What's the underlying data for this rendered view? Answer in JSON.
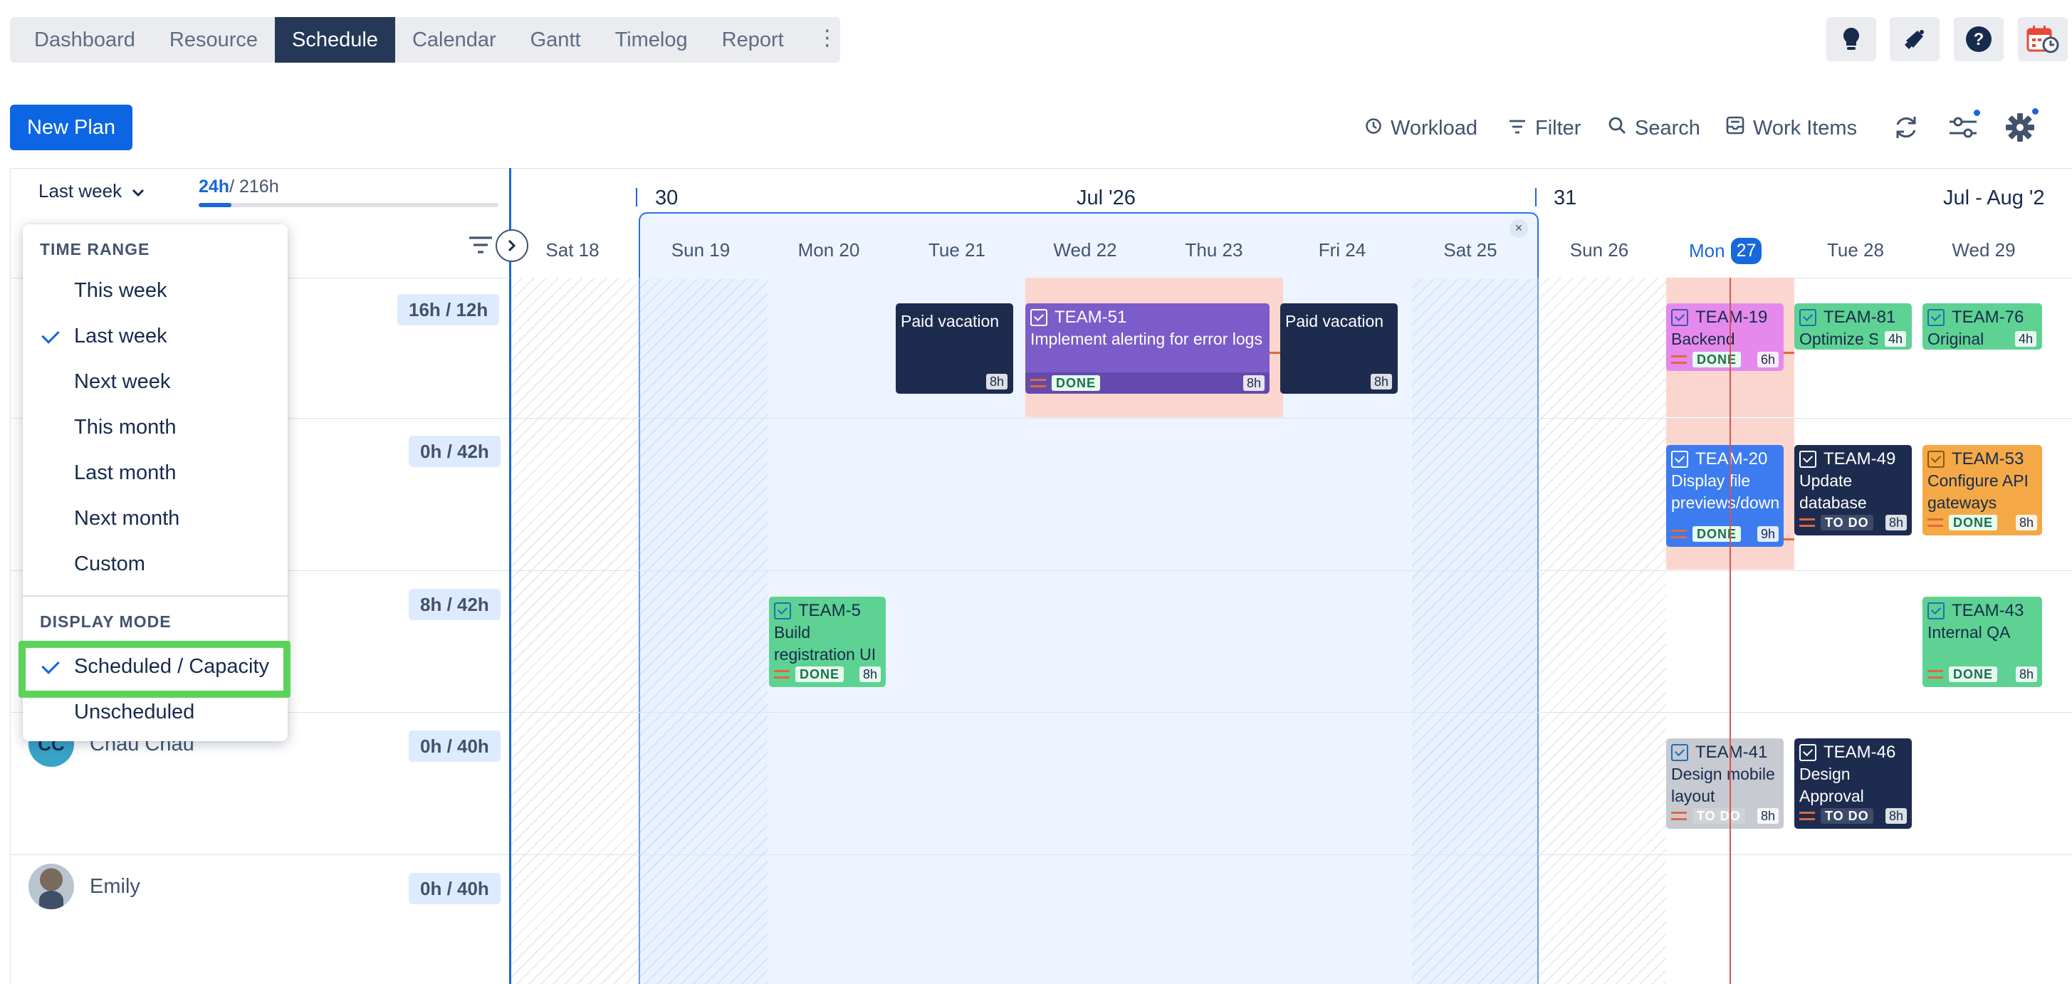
{
  "nav": {
    "tabs": [
      "Dashboard",
      "Resource",
      "Schedule",
      "Calendar",
      "Gantt",
      "Timelog",
      "Report"
    ],
    "active": "Schedule"
  },
  "toolbar": {
    "new_plan": "New Plan",
    "workload": "Workload",
    "filter": "Filter",
    "search": "Search",
    "work_items": "Work Items"
  },
  "range": {
    "selected": "Last week",
    "scheduled": "24h",
    "capacity": "/ 216h",
    "progress_percent": 11
  },
  "menu": {
    "time_range_title": "TIME RANGE",
    "time_range_items": [
      "This week",
      "Last week",
      "Next week",
      "This month",
      "Last month",
      "Next month",
      "Custom"
    ],
    "time_range_selected": "Last week",
    "display_mode_title": "DISPLAY MODE",
    "display_mode_items": [
      "Scheduled / Capacity",
      "Unscheduled"
    ],
    "display_mode_selected": "Scheduled / Capacity"
  },
  "people": [
    {
      "name": "",
      "capacity": "16h / 12h"
    },
    {
      "name": "",
      "capacity": "0h / 42h"
    },
    {
      "name": "",
      "capacity": "8h / 42h"
    },
    {
      "name": "Chau Chau",
      "initials": "CC",
      "capacity": "0h / 40h"
    },
    {
      "name": "Emily",
      "capacity": "0h / 40h"
    }
  ],
  "timeline": {
    "week_labels": [
      "30",
      "Jul '26",
      "31",
      "Jul - Aug '2"
    ],
    "days": [
      "Sat 18",
      "Sun 19",
      "Mon 20",
      "Tue 21",
      "Wed 22",
      "Thu 23",
      "Fri 24",
      "Sat 25",
      "Sun 26",
      "Mon",
      "Tue 28",
      "Wed 29"
    ],
    "today_num": "27"
  },
  "cards": {
    "pv1": {
      "title": "Paid vacation",
      "hours": "8h"
    },
    "t51": {
      "key": "TEAM-51",
      "title": "Implement alerting for error logs",
      "status": "DONE",
      "hours": "8h"
    },
    "pv2": {
      "title": "Paid vacation",
      "hours": "8h"
    },
    "t19": {
      "key": "TEAM-19",
      "title": "Backend",
      "status": "DONE",
      "hours": "6h"
    },
    "t81": {
      "key": "TEAM-81",
      "title": "Optimize SE",
      "hours": "4h"
    },
    "t76": {
      "key": "TEAM-76",
      "title": "Original",
      "hours": "4h"
    },
    "t20": {
      "key": "TEAM-20",
      "title": "Display file previews/downlinks",
      "status": "DONE",
      "hours": "9h"
    },
    "t49": {
      "key": "TEAM-49",
      "title": "Update database",
      "status": "TO DO",
      "hours": "8h"
    },
    "t53": {
      "key": "TEAM-53",
      "title": "Configure API gateways",
      "status": "DONE",
      "hours": "8h"
    },
    "t5": {
      "key": "TEAM-5",
      "title": "Build registration UI",
      "status": "DONE",
      "hours": "8h"
    },
    "t43": {
      "key": "TEAM-43",
      "title": "Internal QA",
      "status": "DONE",
      "hours": "8h"
    },
    "t41": {
      "key": "TEAM-41",
      "title": "Design mobile layout",
      "status": "TO DO",
      "hours": "8h"
    },
    "t46": {
      "key": "TEAM-46",
      "title": "Design Approval",
      "status": "TO DO",
      "hours": "8h"
    }
  },
  "colors": {
    "accent": "#0C66E4",
    "nav_active": "#253858",
    "navy_card": "#1D2B4F",
    "purple_card": "#7B5CC9",
    "pink_card": "#E58AEC",
    "green_card": "#5ED292",
    "blue_card": "#3D7BF0",
    "orange_card": "#F5A946",
    "grey_card": "#C7CAD1",
    "highlight": "#5BD35B",
    "today_line": "#D9534F"
  }
}
